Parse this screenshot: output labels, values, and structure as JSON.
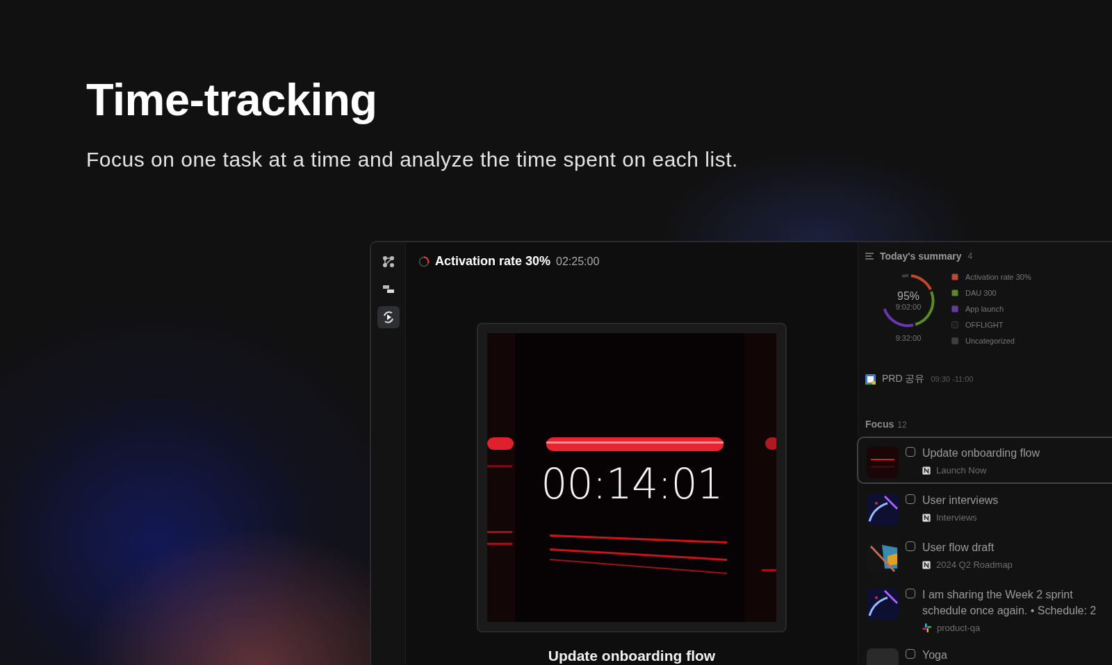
{
  "hero": {
    "title": "Time-tracking",
    "subtitle": "Focus on one task at a time and analyze the time spent on each list."
  },
  "sidebar": [
    {
      "kind": "graph",
      "selected": false
    },
    {
      "kind": "blocks",
      "selected": false
    },
    {
      "kind": "focus",
      "selected": true
    }
  ],
  "header": {
    "task": "Activation rate 30%",
    "time": "02:25:00"
  },
  "timer": {
    "time": "00:14:01",
    "caption": "Update onboarding flow"
  },
  "summary": {
    "title": "Today's summary",
    "count": "4",
    "percent": "95%",
    "tracked": "9:02:00",
    "total": "9:32:00",
    "legend": [
      {
        "label": "Activation rate 30%",
        "color": "#c4462a"
      },
      {
        "label": "DAU 300",
        "color": "#5a8a22"
      },
      {
        "label": "App launch",
        "color": "#6b35b0"
      },
      {
        "label": "OFFLIGHT",
        "color": "#1d1d1f"
      },
      {
        "label": "Uncategorized",
        "color": "#3c3e44"
      }
    ]
  },
  "event": {
    "title": "PRD 공유",
    "time": "09:30 -11:00"
  },
  "focus": {
    "title": "Focus",
    "count": "12",
    "items": [
      {
        "title": "Update onboarding flow",
        "source": {
          "kind": "notion",
          "label": "Launch Now"
        },
        "selected": true,
        "checked": false
      },
      {
        "title": "User interviews",
        "source": {
          "kind": "notion",
          "label": "Interviews"
        },
        "selected": false,
        "checked": false
      },
      {
        "title": "User flow draft",
        "source": {
          "kind": "notion",
          "label": "2024 Q2 Roadmap"
        },
        "selected": false,
        "checked": false
      },
      {
        "title": "I am sharing the Week 2 sprint schedule once again.  • Schedule: 2",
        "source": {
          "kind": "slack",
          "label": "product-qa"
        },
        "selected": false,
        "checked": false
      },
      {
        "title": "Yoga",
        "selected": false,
        "checked": false
      }
    ]
  }
}
